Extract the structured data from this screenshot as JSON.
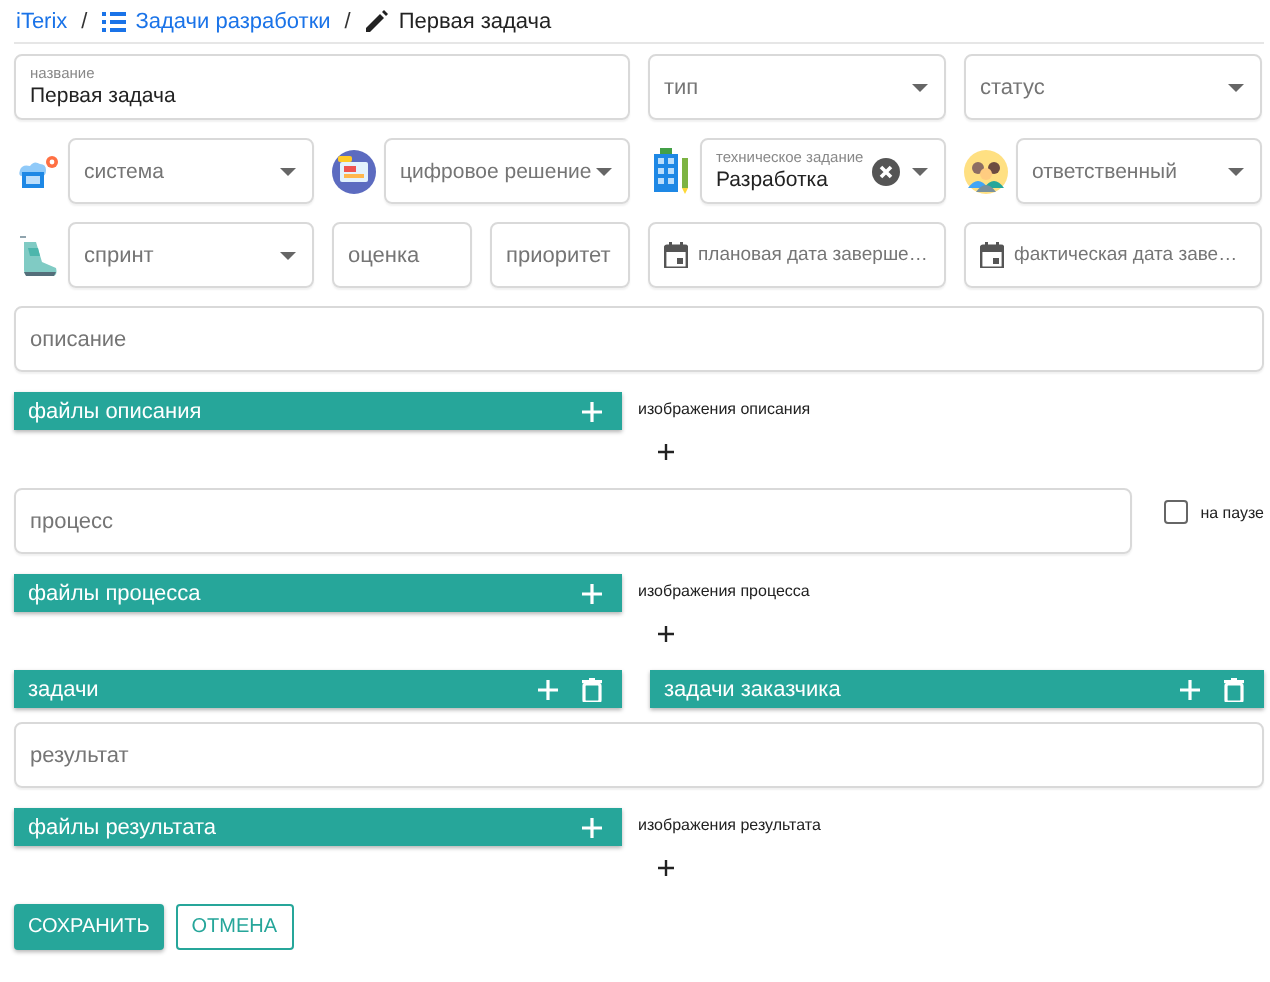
{
  "breadcrumb": [
    {
      "text": "iTerix",
      "kind": "link"
    },
    {
      "text": "/",
      "kind": "separator"
    },
    {
      "text": "Задачи разработки",
      "kind": "list"
    },
    {
      "text": "/",
      "kind": "separator"
    },
    {
      "text": "Первая задача",
      "kind": "current"
    }
  ],
  "fields": [
    {
      "label": "название",
      "value": "Первая задача",
      "kind": "text"
    },
    {
      "label": "тип",
      "kind": "select"
    },
    {
      "label": "статус",
      "kind": "select"
    },
    {
      "label": "система",
      "kind": "select"
    },
    {
      "label": "цифровое решение",
      "kind": "select"
    },
    {
      "label": "техническое задание",
      "value": "Разработка",
      "kind": "select",
      "clearable": true
    },
    {
      "label": "ответственный",
      "kind": "select"
    },
    {
      "label": "спринт",
      "kind": "select"
    },
    {
      "label": "оценка",
      "kind": "text"
    },
    {
      "label": "приоритет",
      "kind": "text"
    },
    {
      "label": "плановая дата заверше…",
      "kind": "date"
    },
    {
      "label": "фактическая дата заве…",
      "kind": "date"
    }
  ],
  "description": {
    "placeholder": "описание"
  },
  "description_files": {
    "title": "файлы описания"
  },
  "description_images": {
    "label": "изображения описания"
  },
  "process": {
    "placeholder": "процесс"
  },
  "paused": {
    "label": "на паузе",
    "checked": false
  },
  "process_files": {
    "title": "файлы процесса"
  },
  "process_images": {
    "label": "изображения процесса"
  },
  "lists": [
    {
      "title": "задачи"
    },
    {
      "title": "задачи заказчика"
    }
  ],
  "result": {
    "placeholder": "результат"
  },
  "result_files": {
    "title": "файлы результата"
  },
  "result_images": {
    "label": "изображения результата"
  },
  "buttons": [
    {
      "label": "СОХРАНИТЬ",
      "kind": "primary"
    },
    {
      "label": "ОТМЕНА",
      "kind": "outline"
    }
  ]
}
